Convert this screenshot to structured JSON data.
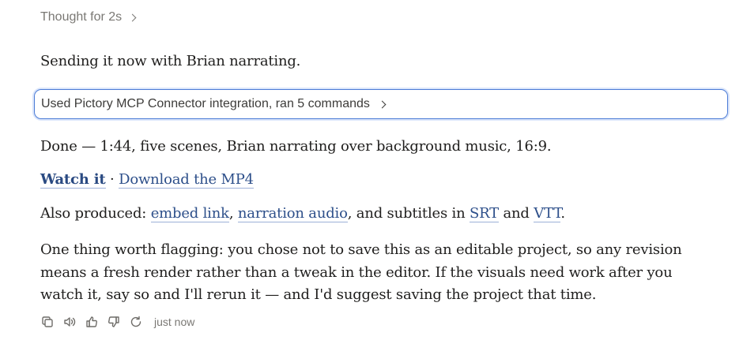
{
  "thought": {
    "label": "Thought for 2s"
  },
  "intro": "Sending it now with Brian narrating.",
  "tool_use": {
    "label": "Used Pictory MCP Connector integration, ran 5 commands"
  },
  "summary": "Done — 1:44, five scenes, Brian narrating over background music, 16:9.",
  "links": {
    "watch": "Watch it",
    "separator": "·",
    "download": "Download the MP4"
  },
  "also": {
    "prefix": "Also produced: ",
    "embed": "embed link",
    "comma": ", ",
    "audio": "narration audio",
    "mid": ", and subtitles in ",
    "srt": "SRT",
    "and": " and ",
    "vtt": "VTT",
    "end": "."
  },
  "flag": "One thing worth flagging: you chose not to save this as an editable project, so any revision means a fresh render rather than a tweak in the editor. If the visuals need work after you watch it, say so and I'll rerun it — and I'd suggest saving the project that time.",
  "actions": {
    "timestamp": "just now",
    "icons": [
      "copy-icon",
      "speaker-icon",
      "thumbs-up-icon",
      "thumbs-down-icon",
      "retry-icon"
    ]
  },
  "colors": {
    "link": "#2d4f8a",
    "tool_border": "#4b7bd6",
    "muted": "#7a7874"
  }
}
